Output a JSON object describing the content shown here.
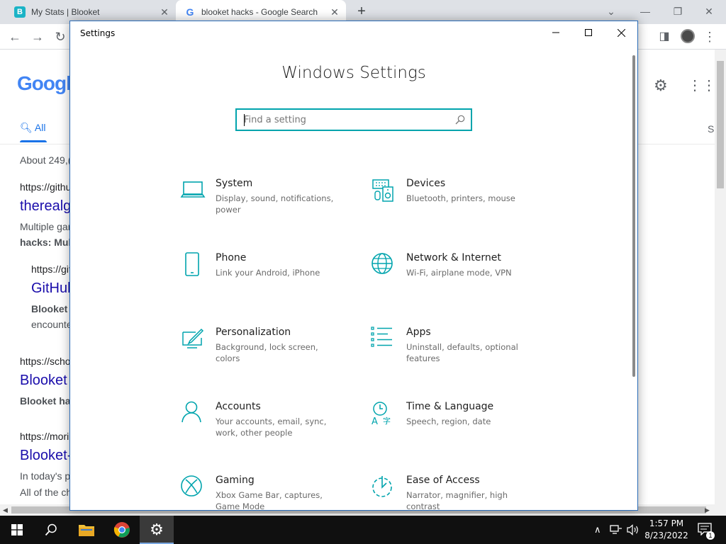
{
  "chrome": {
    "tabs": [
      {
        "title": "My Stats | Blooket",
        "favicon": "B"
      },
      {
        "title": "blooket hacks - Google Search",
        "favicon": "G"
      }
    ],
    "new_tab": "+",
    "google": {
      "logo_text": "Googl",
      "nav_all": "All",
      "nav_right": "S",
      "results_count": "About 249,(",
      "results": [
        {
          "url": "https://githu",
          "title": "therealg",
          "snippet1": "Multiple gar",
          "snippet2": "hacks: Mult"
        },
        {
          "url": "https://git",
          "title": "GitHub",
          "snippet1": "Blooket h",
          "snippet2": "encounte"
        },
        {
          "url": "https://scho",
          "title": "Blooket",
          "snippet1": "Blooket ha"
        },
        {
          "url": "https://mori",
          "title": "Blooket-",
          "snippet1": "In today's p",
          "snippet2": "All of the ch"
        }
      ]
    }
  },
  "settings": {
    "window_title": "Settings",
    "heading": "Windows Settings",
    "search_placeholder": "Find a setting",
    "accent": "#00a4ad",
    "categories": [
      {
        "name": "System",
        "desc": "Display, sound, notifications, power",
        "icon": "laptop-icon"
      },
      {
        "name": "Devices",
        "desc": "Bluetooth, printers, mouse",
        "icon": "devices-icon"
      },
      {
        "name": "Phone",
        "desc": "Link your Android, iPhone",
        "icon": "phone-icon"
      },
      {
        "name": "Network & Internet",
        "desc": "Wi-Fi, airplane mode, VPN",
        "icon": "globe-icon"
      },
      {
        "name": "Personalization",
        "desc": "Background, lock screen, colors",
        "icon": "paint-icon"
      },
      {
        "name": "Apps",
        "desc": "Uninstall, defaults, optional features",
        "icon": "apps-list-icon"
      },
      {
        "name": "Accounts",
        "desc": "Your accounts, email, sync, work, other people",
        "icon": "person-icon"
      },
      {
        "name": "Time & Language",
        "desc": "Speech, region, date",
        "icon": "time-language-icon"
      },
      {
        "name": "Gaming",
        "desc": "Xbox Game Bar, captures, Game Mode",
        "icon": "xbox-icon"
      },
      {
        "name": "Ease of Access",
        "desc": "Narrator, magnifier, high contrast",
        "icon": "ease-of-access-icon"
      }
    ]
  },
  "taskbar": {
    "time": "1:57 PM",
    "date": "8/23/2022",
    "notification_count": "1"
  }
}
